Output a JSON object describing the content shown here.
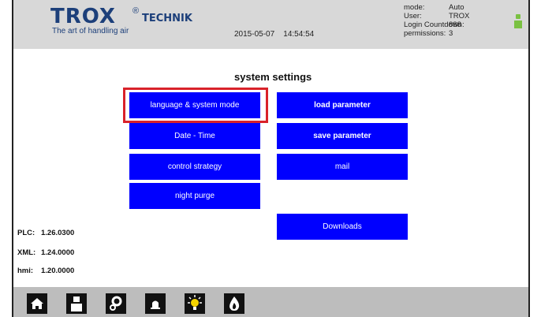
{
  "header": {
    "logo_main": "TROX",
    "logo_registered": "®",
    "logo_sub": "TECHNIK",
    "tagline": "The art of handling air",
    "date": "2015-05-07",
    "time": "14:54:54",
    "status": [
      {
        "key": "mode:",
        "value": "Auto"
      },
      {
        "key": "User:",
        "value": "TROX"
      },
      {
        "key": "Login Countdown:",
        "value": "888"
      },
      {
        "key": "permissions:",
        "value": "3"
      }
    ]
  },
  "page": {
    "title": "system settings"
  },
  "buttons": {
    "language": "language & system mode",
    "date_time": "Date - Time",
    "control_strategy": "control strategy",
    "night_purge": "night purge",
    "load_parameter": "load parameter",
    "save_parameter": "save parameter",
    "mail": "mail",
    "downloads": "Downloads"
  },
  "versions": [
    {
      "label": "PLC:",
      "value": "1.26.0300"
    },
    {
      "label": "XML:",
      "value": "1.24.0000"
    },
    {
      "label": "hmi:",
      "value": "1.20.0000"
    }
  ],
  "footer": {
    "icons": [
      "home-icon",
      "user-icon",
      "settings-icon",
      "bell-icon",
      "lightbulb-icon",
      "fire-icon"
    ]
  },
  "colors": {
    "button_blue": "#0000ff",
    "highlight_red": "#d9222a",
    "logo_blue": "#1c3f7a",
    "user_status_green": "#7ac142"
  }
}
